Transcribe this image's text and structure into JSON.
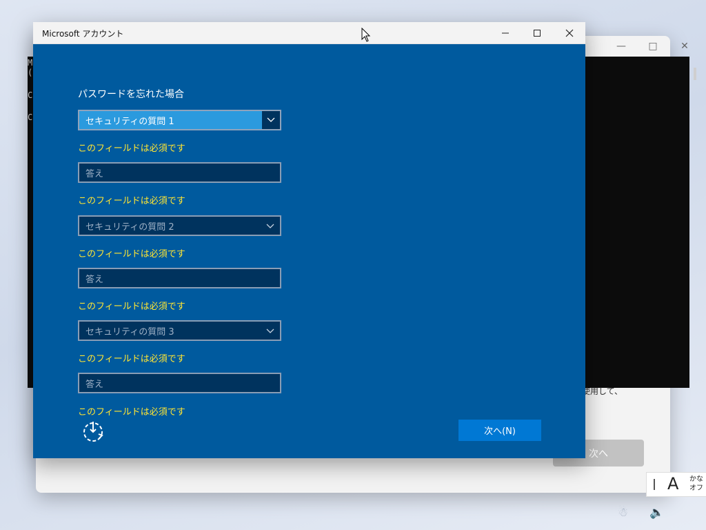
{
  "background": {
    "console_lines": [
      "M",
      "(",
      "C",
      "C"
    ],
    "partial_text": "を使用して、",
    "next_label": "次へ",
    "tray": {
      "ime_mode": "A",
      "ime_kana": "かな",
      "ime_off": "オフ"
    }
  },
  "dialog": {
    "title": "Microsoft アカウント",
    "heading": "パスワードを忘れた場合",
    "questions": [
      {
        "select_label": "セキュリティの質問 1",
        "answer_placeholder": "答え"
      },
      {
        "select_label": "セキュリティの質問 2",
        "answer_placeholder": "答え"
      },
      {
        "select_label": "セキュリティの質問 3",
        "answer_placeholder": "答え"
      }
    ],
    "required_msg": "このフィールドは必須です",
    "next_label": "次へ(N)",
    "colors": {
      "background": "#005a9e",
      "accent": "#0078d4",
      "error": "#ffe533"
    },
    "icons": [
      "minimize-icon",
      "maximize-icon",
      "close-icon",
      "chevron-down-icon",
      "update-icon"
    ]
  }
}
